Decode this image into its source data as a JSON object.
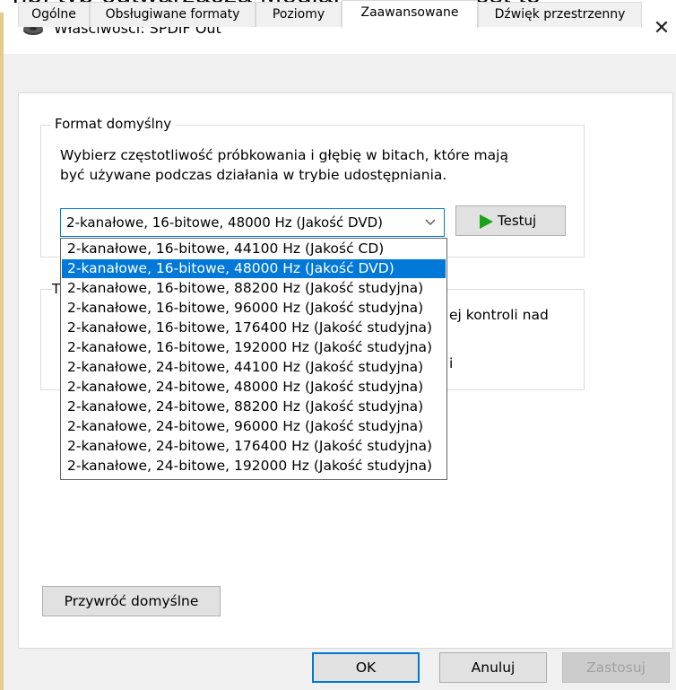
{
  "window": {
    "title": "Właściwości: SPDIF Out",
    "icon": "speaker-icon",
    "close_symbol": "✕"
  },
  "top_strip_text": "np. typ odtwarzacza  MediaPlayer itd. Jest to",
  "tabs": [
    {
      "label": "Ogólne",
      "active": false
    },
    {
      "label": "Obsługiwane formaty",
      "active": false
    },
    {
      "label": "Poziomy",
      "active": false
    },
    {
      "label": "Zaawansowane",
      "active": true
    },
    {
      "label": "Dźwięk przestrzenny",
      "active": false
    }
  ],
  "default_format": {
    "legend": "Format domyślny",
    "description_line1": "Wybierz częstotliwość próbkowania i głębię w bitach, które mają",
    "description_line2": "być używane podczas działania w trybie udostępniania.",
    "selected_value": "2-kanałowe, 16-bitowe, 48000 Hz (Jakość DVD)",
    "test_button": "Testuj",
    "options": [
      "2-kanałowe, 16-bitowe, 44100 Hz (Jakość CD)",
      "2-kanałowe, 16-bitowe, 48000 Hz (Jakość DVD)",
      "2-kanałowe, 16-bitowe, 88200 Hz (Jakość studyjna)",
      "2-kanałowe, 16-bitowe, 96000 Hz (Jakość studyjna)",
      "2-kanałowe, 16-bitowe, 176400 Hz (Jakość studyjna)",
      "2-kanałowe, 16-bitowe, 192000 Hz (Jakość studyjna)",
      "2-kanałowe, 24-bitowe, 44100 Hz (Jakość studyjna)",
      "2-kanałowe, 24-bitowe, 48000 Hz (Jakość studyjna)",
      "2-kanałowe, 24-bitowe, 88200 Hz (Jakość studyjna)",
      "2-kanałowe, 24-bitowe, 96000 Hz (Jakość studyjna)",
      "2-kanałowe, 24-bitowe, 176400 Hz (Jakość studyjna)",
      "2-kanałowe, 24-bitowe, 192000 Hz (Jakość studyjna)"
    ],
    "selected_index": 1
  },
  "exclusive_group": {
    "legend_letter": "T",
    "text_line1": "ej kontroli nad",
    "text_line2": "i"
  },
  "restore_button": "Przywróć domyślne",
  "footer": {
    "ok": "OK",
    "cancel": "Anuluj",
    "apply": "Zastosuj"
  },
  "colors": {
    "accent": "#0078d7",
    "play_green": "#1aa31a",
    "dialog_bg": "#f0f0f0"
  }
}
